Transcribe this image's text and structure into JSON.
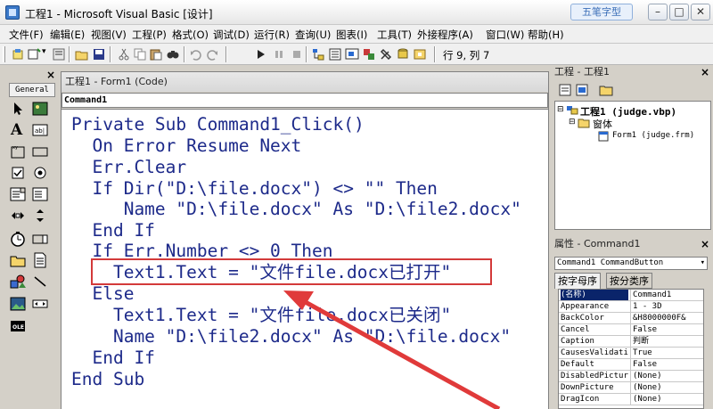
{
  "window": {
    "title": "工程1 - Microsoft Visual Basic [设计]",
    "ime_badge": "五笔字型",
    "min_label": "–",
    "max_label": "□",
    "close_label": "✕"
  },
  "menu": [
    "文件(F)",
    "编辑(E)",
    "视图(V)",
    "工程(P)",
    "格式(O)",
    "调试(D)",
    "运行(R)",
    "查询(U)",
    "图表(I)",
    "工具(T)",
    "外接程序(A)",
    "窗口(W)",
    "帮助(H)"
  ],
  "toolbar": {
    "cursor_position": "行 9, 列 7"
  },
  "toolbox": {
    "tab_label": "General",
    "close_label": "×",
    "tools": [
      "pointer-icon",
      "picturebox-icon",
      "label-icon",
      "textbox-icon",
      "frame-icon",
      "commandbutton-icon",
      "checkbox-icon",
      "optionbutton-icon",
      "combobox-icon",
      "listbox-icon",
      "hscrollbar-icon",
      "vscrollbar-icon",
      "timer-icon",
      "drivelistbox-icon",
      "dirlistbox-icon",
      "filelistbox-icon",
      "shape-icon",
      "line-icon",
      "image-icon",
      "data-icon",
      "ole-icon"
    ]
  },
  "code_window": {
    "title": "工程1 - Form1 (Code)",
    "object_combo": "Command1",
    "lines": [
      "Private Sub Command1_Click()",
      "  On Error Resume Next",
      "  Err.Clear",
      "  If Dir(\"D:\\file.docx\") <> \"\" Then",
      "     Name \"D:\\file.docx\" As \"D:\\file2.docx\"",
      "  End If",
      "  If Err.Number <> 0 Then",
      "    Text1.Text = \"文件file.docx已打开\"",
      "  Else",
      "    Text1.Text = \"文件file.docx已关闭\"",
      "    Name \"D:\\file2.docx\" As \"D:\\file.docx\"",
      "  End If",
      "End Sub"
    ],
    "highlight_color": "#d33a3a"
  },
  "project_panel": {
    "title": "工程 - 工程1",
    "close_label": "×",
    "project_node": "工程1 (judge.vbp)",
    "forms_folder": "窗体",
    "form_node": "Form1 (judge.frm)"
  },
  "properties_panel": {
    "title": "属性 - Command1",
    "close_label": "×",
    "object_combo": "Command1 CommandButton",
    "tab_alpha": "按字母序",
    "tab_category": "按分类序",
    "rows": [
      {
        "name": "(名称)",
        "value": "Command1"
      },
      {
        "name": "Appearance",
        "value": "1 - 3D"
      },
      {
        "name": "BackColor",
        "value": "&H8000000F&"
      },
      {
        "name": "Cancel",
        "value": "False"
      },
      {
        "name": "Caption",
        "value": "判断"
      },
      {
        "name": "CausesValidati",
        "value": "True"
      },
      {
        "name": "Default",
        "value": "False"
      },
      {
        "name": "DisabledPictur",
        "value": "(None)"
      },
      {
        "name": "DownPicture",
        "value": "(None)"
      },
      {
        "name": "DragIcon",
        "value": "(None)"
      }
    ]
  }
}
